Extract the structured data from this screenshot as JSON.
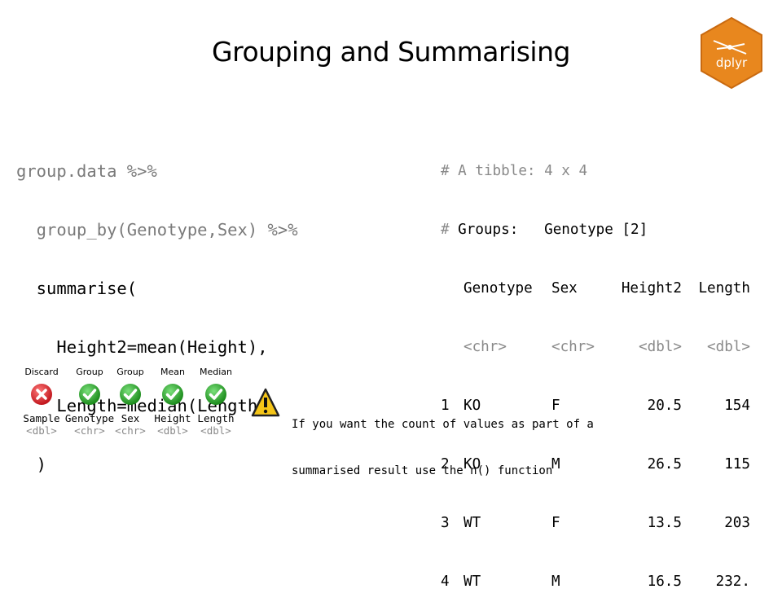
{
  "slide": {
    "title": "Grouping and Summarising",
    "logo_text": "dplyr",
    "logo_color": "#E07B20"
  },
  "code": {
    "lines": [
      {
        "text": "group.data %>%",
        "style": "gray"
      },
      {
        "text": "  group_by(Genotype,Sex) %>%",
        "style": "gray"
      },
      {
        "text": "  summarise(",
        "style": "black"
      },
      {
        "text": "    Height2=mean(Height),",
        "style": "black"
      },
      {
        "text": "    Length=median(Length)",
        "style": "black"
      },
      {
        "text": "  )",
        "style": "black"
      }
    ]
  },
  "output": {
    "header1": "# A tibble: 4 x 4",
    "header2": "# Groups:   Genotype [2]",
    "columns": [
      "Genotype",
      "Sex",
      "Height2",
      "Length"
    ],
    "types": [
      "<chr>",
      "<chr>",
      "<dbl>",
      "<dbl>"
    ],
    "rows": [
      {
        "idx": "1",
        "Genotype": "KO",
        "Sex": "F",
        "Height2": "20.5",
        "Length": "154"
      },
      {
        "idx": "2",
        "Genotype": "KO",
        "Sex": "M",
        "Height2": "26.5",
        "Length": "115"
      },
      {
        "idx": "3",
        "Genotype": "WT",
        "Sex": "F",
        "Height2": "13.5",
        "Length": "203"
      },
      {
        "idx": "4",
        "Genotype": "WT",
        "Sex": "M",
        "Height2": "16.5",
        "Length": "232."
      }
    ]
  },
  "legend": [
    {
      "action": "Discard",
      "icon": "cross-icon",
      "name": "Sample",
      "type": "<dbl>"
    },
    {
      "action": "Group",
      "icon": "check-icon",
      "name": "Genotype",
      "type": "<chr>"
    },
    {
      "action": "Group",
      "icon": "check-icon",
      "name": "Sex",
      "type": "<chr>"
    },
    {
      "action": "Mean",
      "icon": "check-icon",
      "name": "Height",
      "type": "<dbl>"
    },
    {
      "action": "Median",
      "icon": "check-icon",
      "name": "Length",
      "type": "<dbl>"
    }
  ],
  "note": {
    "icon": "warning-icon",
    "line1": "If you want the count of values as part of a",
    "line2": "summarised result use the n() function"
  },
  "colors": {
    "discard_red": "#D9252B",
    "check_green": "#2E9E2E",
    "warning_yellow": "#F5C518"
  }
}
